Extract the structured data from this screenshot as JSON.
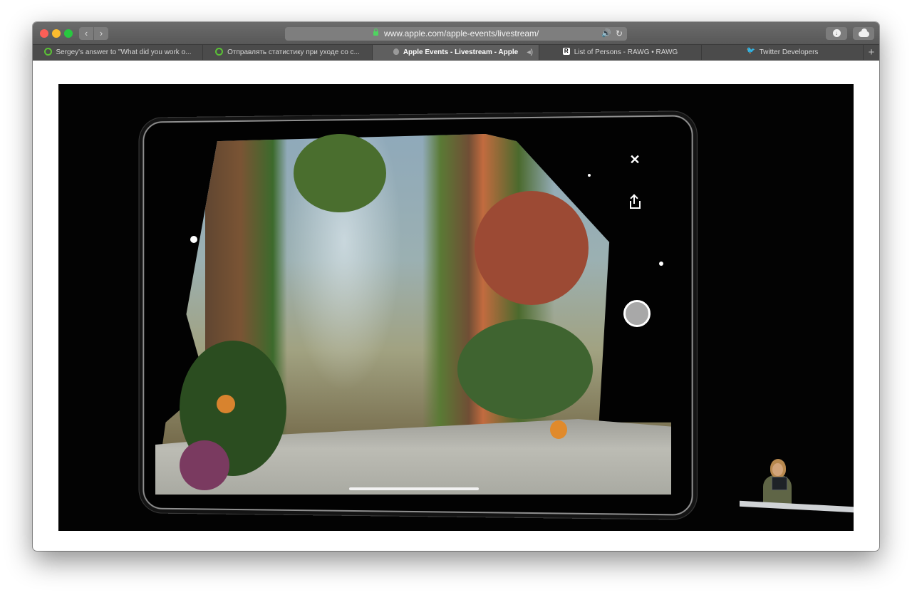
{
  "browser": {
    "url": "www.apple.com/apple-events/livestream/",
    "tabs": [
      {
        "title": "Sergey's answer to \"What did you work o...",
        "icon": "quora-icon",
        "active": false
      },
      {
        "title": "Отправлять статистику при уходе со с...",
        "icon": "quora-icon",
        "active": false
      },
      {
        "title": "Apple Events - Livestream - Apple",
        "icon": "apple-icon",
        "active": true,
        "audio_playing": true
      },
      {
        "title": "List of Persons - RAWG • RAWG",
        "icon": "rawg-icon",
        "icon_letter": "R",
        "active": false
      },
      {
        "title": "Twitter Developers",
        "icon": "twitter-icon",
        "active": false
      }
    ]
  },
  "icons": {
    "back": "chevron-left-icon",
    "forward": "chevron-right-icon",
    "lock": "lock-icon",
    "audio": "speaker-icon",
    "reload": "reload-icon",
    "download": "download-icon",
    "icloud": "cloud-icon",
    "new_tab": "plus-icon",
    "ar_close": "close-icon",
    "ar_share": "share-icon",
    "ar_capture": "shutter-icon"
  },
  "glyphs": {
    "back": "‹",
    "forward": "›",
    "audio": "🔊",
    "audio_tab": "◂)",
    "reload": "↻",
    "download": "↓",
    "new_tab": "+",
    "twitter": "🐦",
    "close": "✕"
  },
  "colors": {
    "close": "#fc5f57",
    "minimize": "#fdbc2e",
    "maximize": "#28c840",
    "secure_lock": "#4fd460",
    "audio_indicator": "#58b8ff"
  }
}
